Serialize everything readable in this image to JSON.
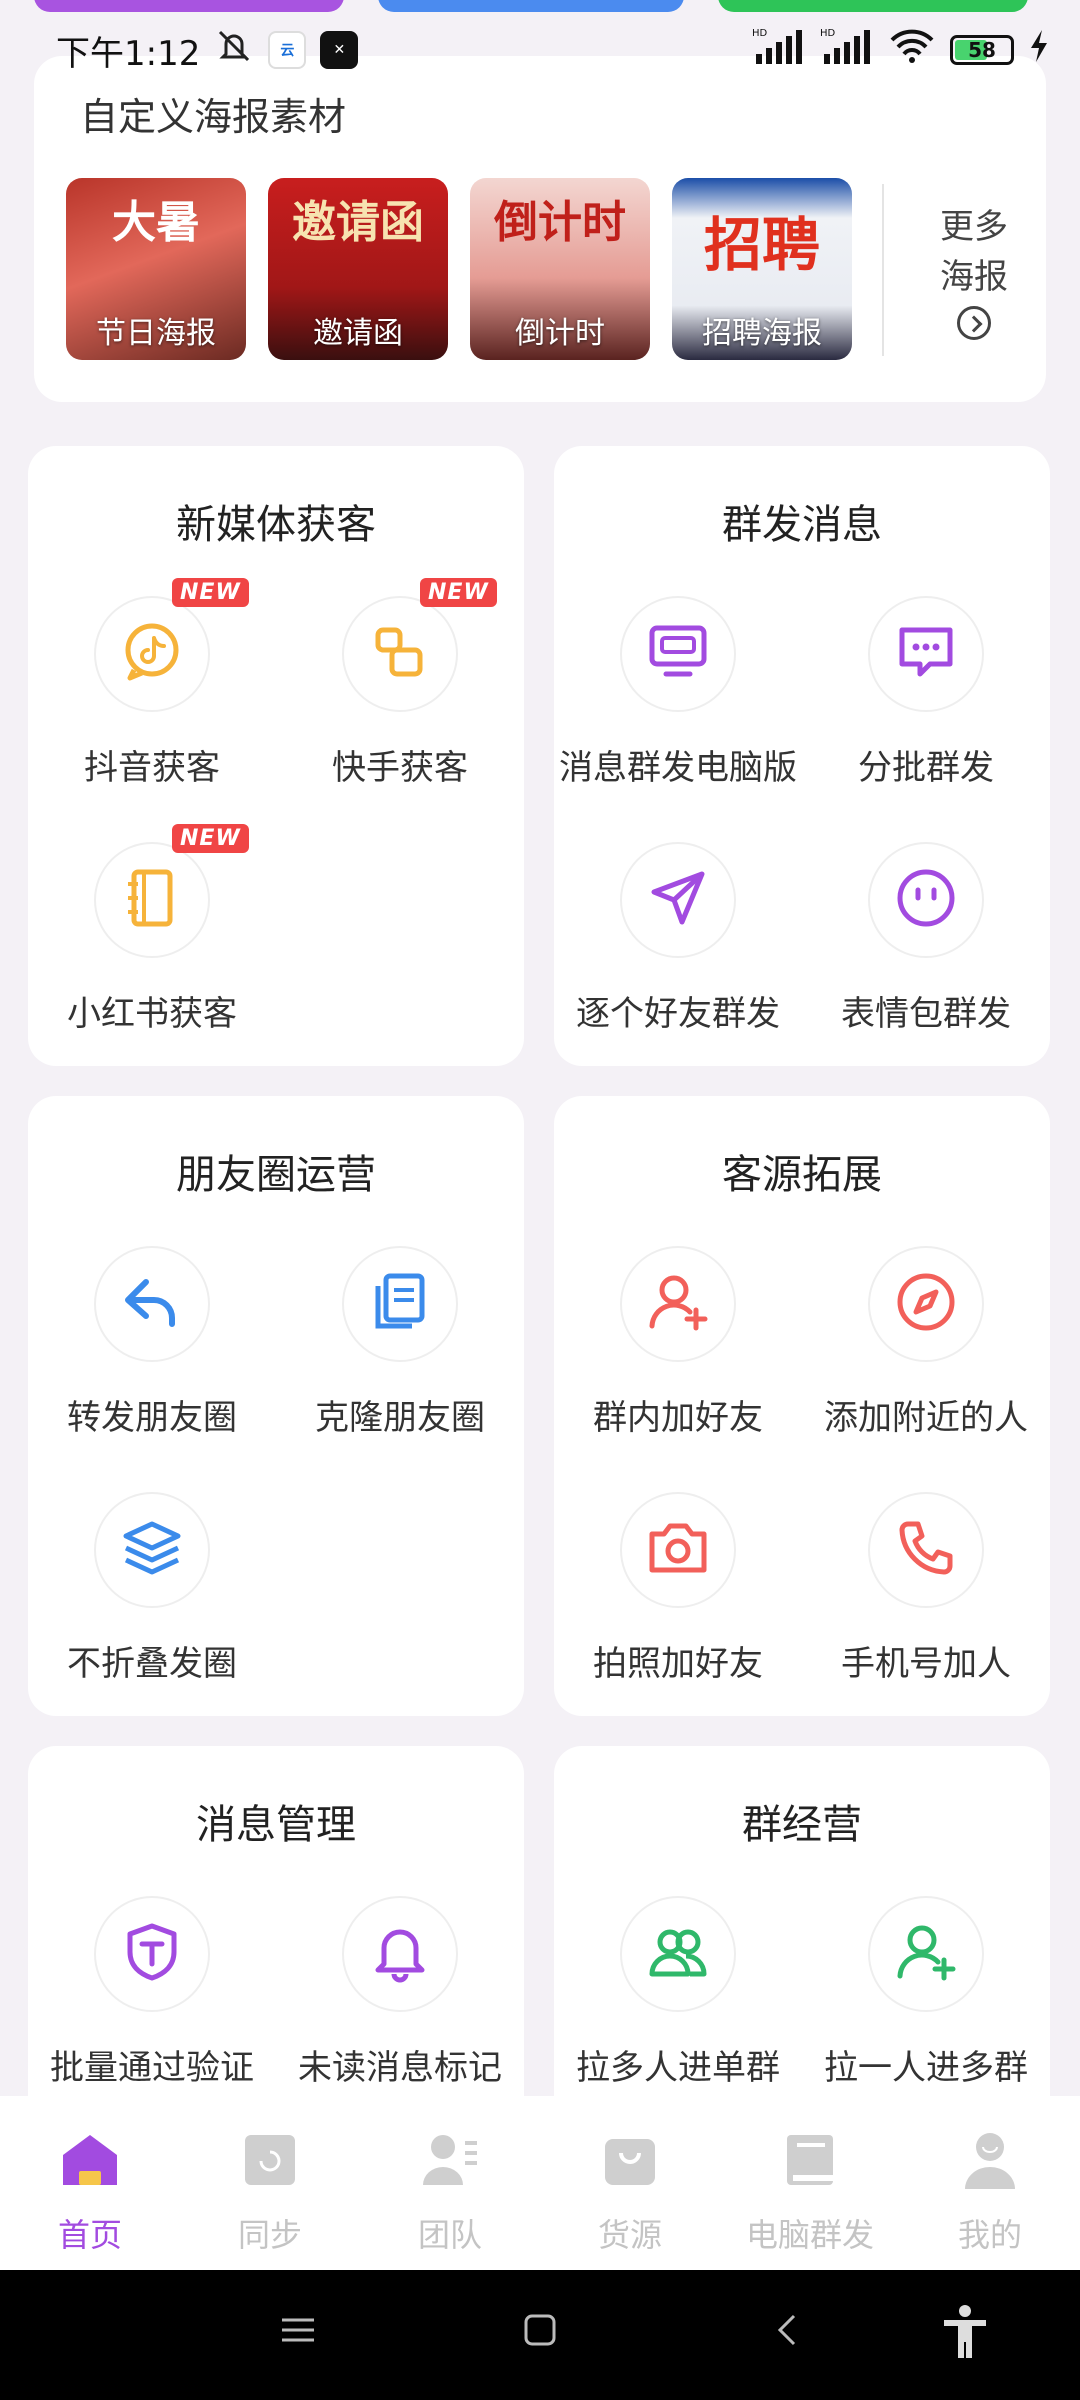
{
  "status_bar": {
    "time": "下午1:12",
    "battery": "58",
    "signal_labels": [
      "HD",
      "HD"
    ]
  },
  "posters": {
    "title": "自定义海报素材",
    "items": [
      {
        "art": "大暑",
        "label": "节日海报"
      },
      {
        "art": "邀请函",
        "label": "邀请函"
      },
      {
        "art": "倒计时",
        "label": "倒计时"
      },
      {
        "art": "招聘",
        "label": "招聘海报"
      }
    ],
    "more_line1": "更多",
    "more_line2": "海报"
  },
  "sections": [
    {
      "title": "新媒体获客",
      "items": [
        {
          "label": "抖音获客",
          "icon": "douyin-icon",
          "badge": "NEW"
        },
        {
          "label": "快手获客",
          "icon": "kuaishou-icon",
          "badge": "NEW"
        },
        {
          "label": "小红书获客",
          "icon": "notebook-icon",
          "badge": "NEW"
        }
      ]
    },
    {
      "title": "群发消息",
      "items": [
        {
          "label": "消息群发电脑版",
          "icon": "monitor-icon"
        },
        {
          "label": "分批群发",
          "icon": "chat-bubble-icon"
        },
        {
          "label": "逐个好友群发",
          "icon": "send-icon"
        },
        {
          "label": "表情包群发",
          "icon": "emoji-icon"
        }
      ]
    },
    {
      "title": "朋友圈运营",
      "items": [
        {
          "label": "转发朋友圈",
          "icon": "reply-arrow-icon"
        },
        {
          "label": "克隆朋友圈",
          "icon": "copy-icon"
        },
        {
          "label": "不折叠发圈",
          "icon": "layers-icon"
        }
      ]
    },
    {
      "title": "客源拓展",
      "items": [
        {
          "label": "群内加好友",
          "icon": "add-user-icon"
        },
        {
          "label": "添加附近的人",
          "icon": "compass-icon"
        },
        {
          "label": "拍照加好友",
          "icon": "camera-icon"
        },
        {
          "label": "手机号加人",
          "icon": "phone-icon"
        }
      ]
    },
    {
      "title": "消息管理",
      "items": [
        {
          "label": "批量通过验证",
          "icon": "shield-icon"
        },
        {
          "label": "未读消息标记",
          "icon": "bell-icon"
        }
      ]
    },
    {
      "title": "群经营",
      "items": [
        {
          "label": "拉多人进单群",
          "icon": "group-icon"
        },
        {
          "label": "拉一人进多群",
          "icon": "user-plus-icon"
        }
      ]
    }
  ],
  "bottom_nav": [
    {
      "label": "首页",
      "icon": "home-icon",
      "active": true
    },
    {
      "label": "同步",
      "icon": "sync-icon"
    },
    {
      "label": "团队",
      "icon": "team-icon"
    },
    {
      "label": "货源",
      "icon": "bag-icon"
    },
    {
      "label": "电脑群发",
      "icon": "book-icon"
    },
    {
      "label": "我的",
      "icon": "profile-icon"
    }
  ],
  "colors": {
    "accent": "#A24BE0",
    "new_badge": "#F04545",
    "inactive_nav": "#C4C4C4",
    "background": "#F4F1F6"
  }
}
